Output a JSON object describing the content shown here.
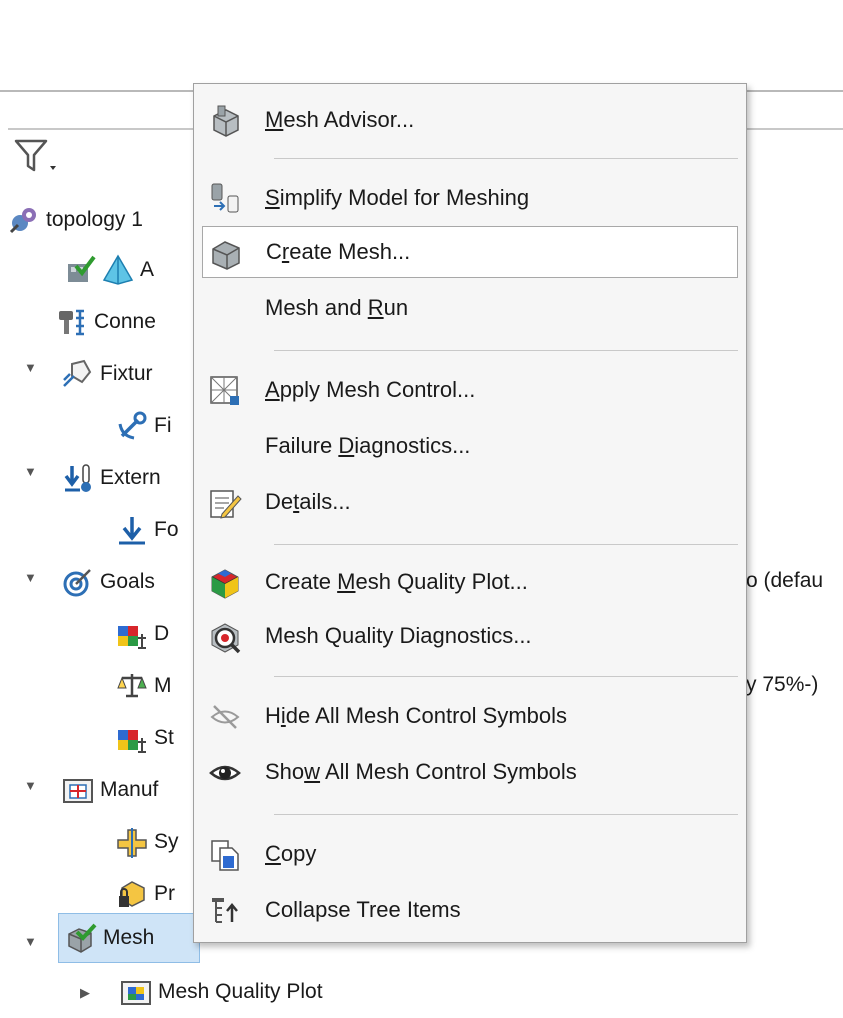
{
  "tree": {
    "root": "topology 1",
    "rows": [
      {
        "label": "A"
      },
      {
        "label": "Conne"
      },
      {
        "label": "Fixtur"
      },
      {
        "label": "Fi"
      },
      {
        "label": "Extern"
      },
      {
        "label": "Fo"
      },
      {
        "label": "Goals"
      },
      {
        "label": "D"
      },
      {
        "label": "M"
      },
      {
        "label": "St"
      },
      {
        "label": "Manuf"
      },
      {
        "label": "Sy"
      },
      {
        "label": "Pr"
      },
      {
        "label": "Mesh"
      },
      {
        "label": "Mesh Quality Plot"
      }
    ],
    "tail_goals": "o (defau",
    "tail_m": "y 75%-)"
  },
  "menu": {
    "items": [
      {
        "id": "mesh-advisor",
        "pre": "",
        "ul": "M",
        "post": "esh Advisor..."
      },
      {
        "id": "simplify-model",
        "pre": "",
        "ul": "S",
        "post": "implify Model for Meshing"
      },
      {
        "id": "create-mesh",
        "pre": "C",
        "ul": "r",
        "post": "eate Mesh..."
      },
      {
        "id": "mesh-and-run",
        "pre": "Mesh and ",
        "ul": "R",
        "post": "un"
      },
      {
        "id": "apply-mesh-control",
        "pre": "",
        "ul": "A",
        "post": "pply Mesh Control..."
      },
      {
        "id": "failure-diagnostics",
        "pre": "Failure ",
        "ul": "D",
        "post": "iagnostics..."
      },
      {
        "id": "details",
        "pre": "De",
        "ul": "t",
        "post": "ails..."
      },
      {
        "id": "create-mesh-quality-plot",
        "pre": "Create ",
        "ul": "M",
        "post": "esh Quality Plot..."
      },
      {
        "id": "mesh-quality-diagnostics",
        "pre": "Mesh Quality Diagnostics...",
        "ul": "",
        "post": ""
      },
      {
        "id": "hide-mesh-control-symbols",
        "pre": "H",
        "ul": "i",
        "post": "de All Mesh Control Symbols"
      },
      {
        "id": "show-mesh-control-symbols",
        "pre": "Sho",
        "ul": "w",
        "post": " All Mesh Control Symbols"
      },
      {
        "id": "copy",
        "pre": "",
        "ul": "C",
        "post": "opy"
      },
      {
        "id": "collapse-tree-items",
        "pre": "Collapse Tree Items",
        "ul": "",
        "post": ""
      }
    ]
  }
}
